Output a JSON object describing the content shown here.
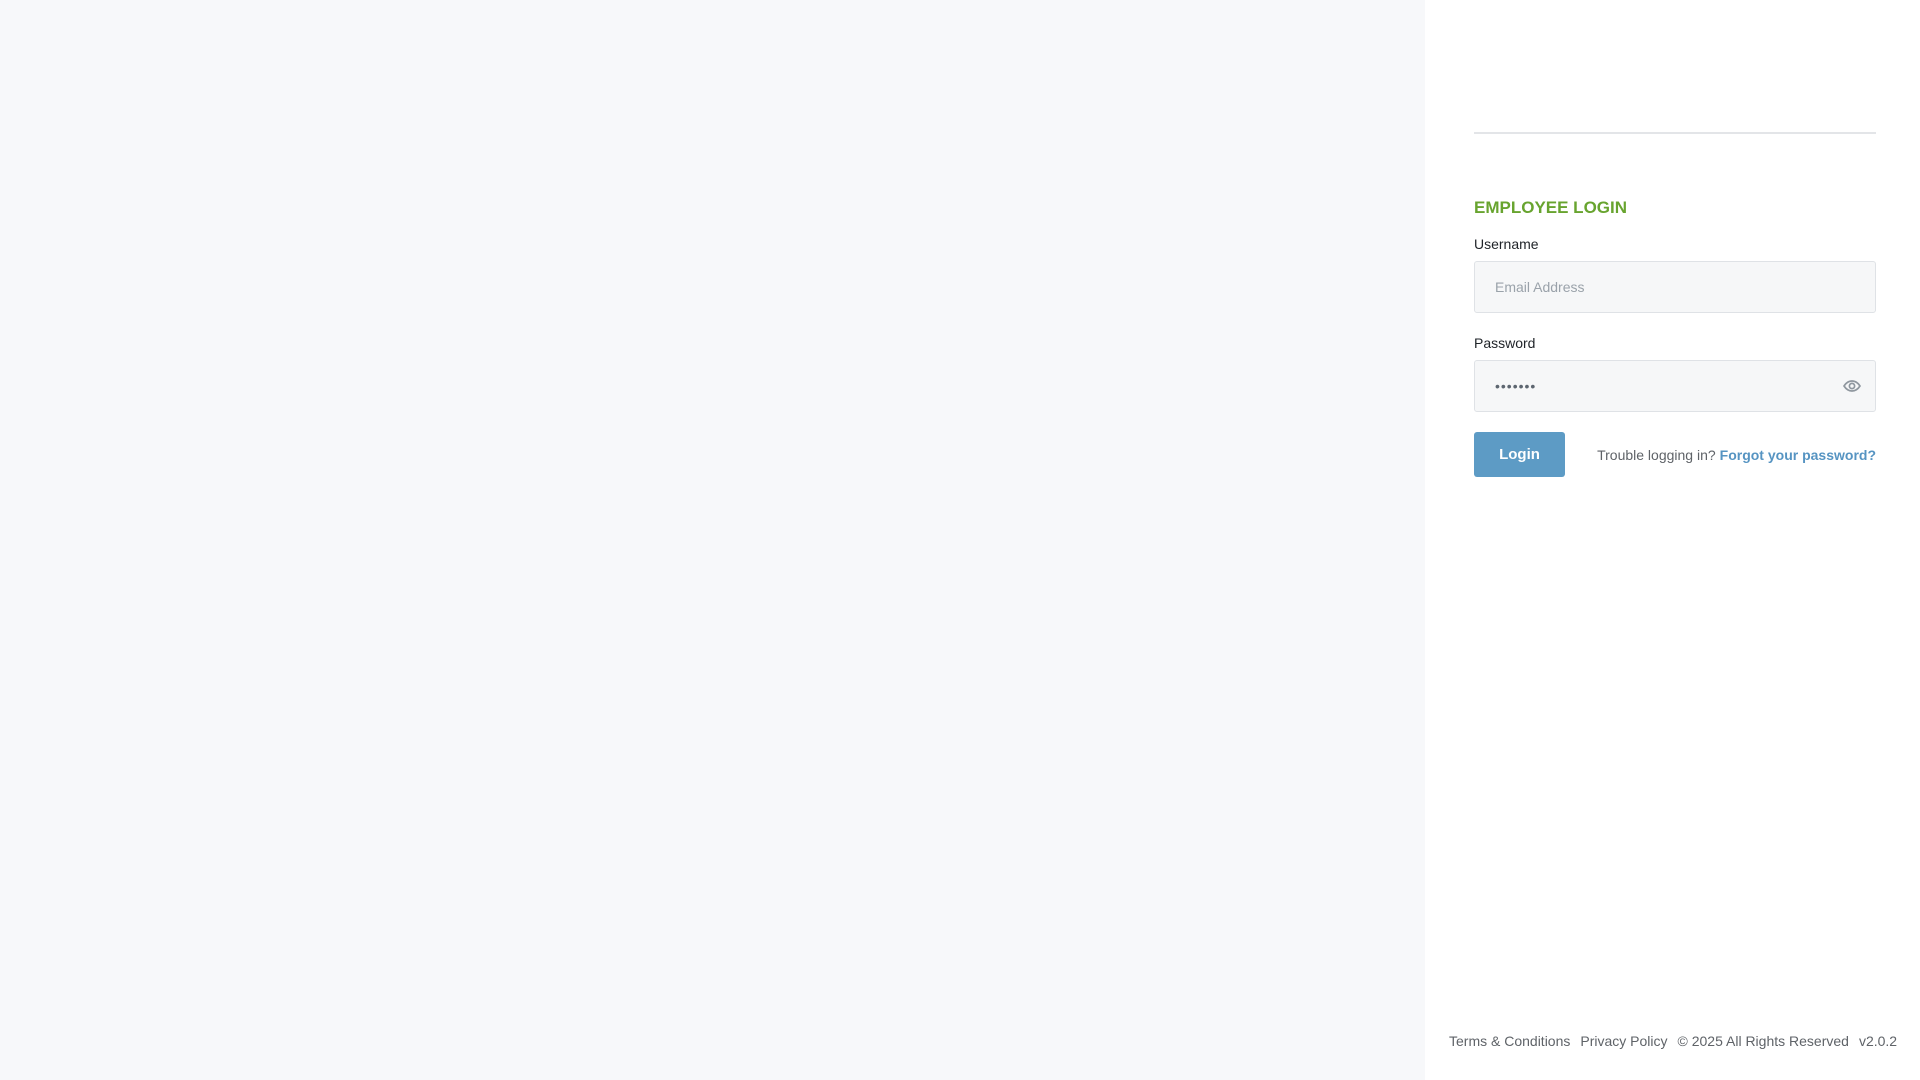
{
  "login": {
    "title": "EMPLOYEE LOGIN",
    "username_label": "Username",
    "username_placeholder": "Email Address",
    "password_label": "Password",
    "password_value": "•••••••",
    "login_button": "Login",
    "trouble_text": "Trouble logging in?",
    "forgot_link": "Forgot your password?"
  },
  "footer": {
    "terms": "Terms & Conditions",
    "privacy": "Privacy Policy",
    "copyright": "© 2025 All Rights Reserved",
    "version": "v2.0.2"
  },
  "colors": {
    "left_background": "#f7f8fa",
    "title_green": "#68a42f",
    "button_blue": "#5d9bc5",
    "link_blue": "#5694c2"
  },
  "icons": {
    "password_toggle": "eye-icon"
  }
}
